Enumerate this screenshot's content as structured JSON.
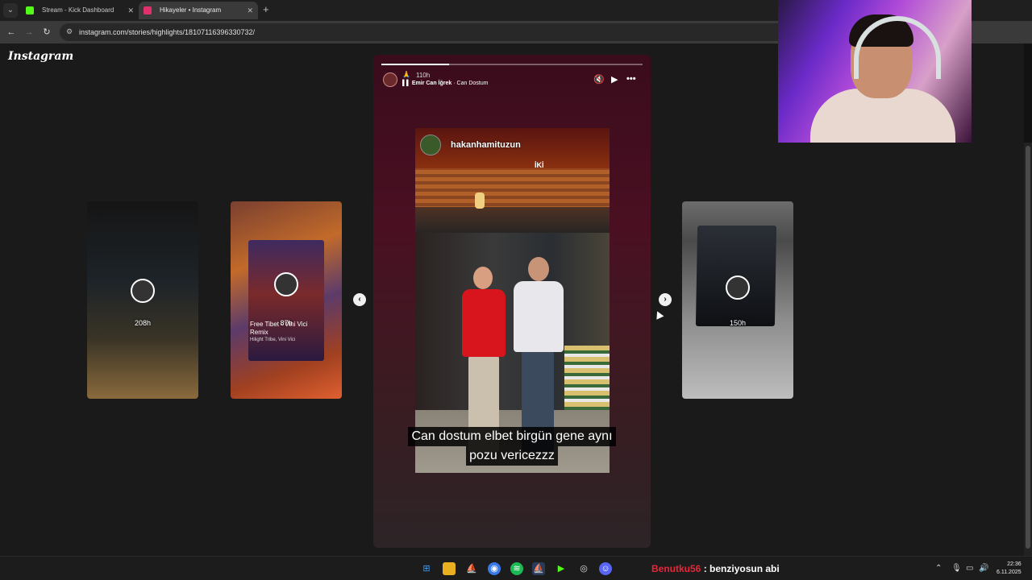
{
  "browser": {
    "tabs": [
      {
        "title": "Stream - Kick Dashboard",
        "favicon_color": "#53fc18"
      },
      {
        "title": "Hikayeler • Instagram",
        "favicon_color": "#e1306c"
      }
    ],
    "url": "instagram.com/stories/highlights/18107116396330732/"
  },
  "page": {
    "logo": "Instagram",
    "story": {
      "progress": 0.26,
      "time": "110h",
      "song_artist": "Emir Can İğrek",
      "song_separator": " · ",
      "song_title": "Can Dostum",
      "photo_username": "hakanhamituzun",
      "photo_overlay": "İKİ",
      "caption_line1": "Can dostum elbet birgün gene aynı",
      "caption_line2": "pozu vericezzz"
    },
    "side_cards": [
      {
        "label": "208h"
      },
      {
        "label": "87h",
        "song_title": "Free Tibet - Vini Vici Remix",
        "song_artist": "Hilight Tribe, Vini Vici"
      },
      {
        "label": "150h"
      }
    ]
  },
  "taskbar": {
    "chat_user": "Benutku56",
    "chat_msg": " : benziyosun abi",
    "time": "22:36",
    "date": "6.11.2025"
  }
}
